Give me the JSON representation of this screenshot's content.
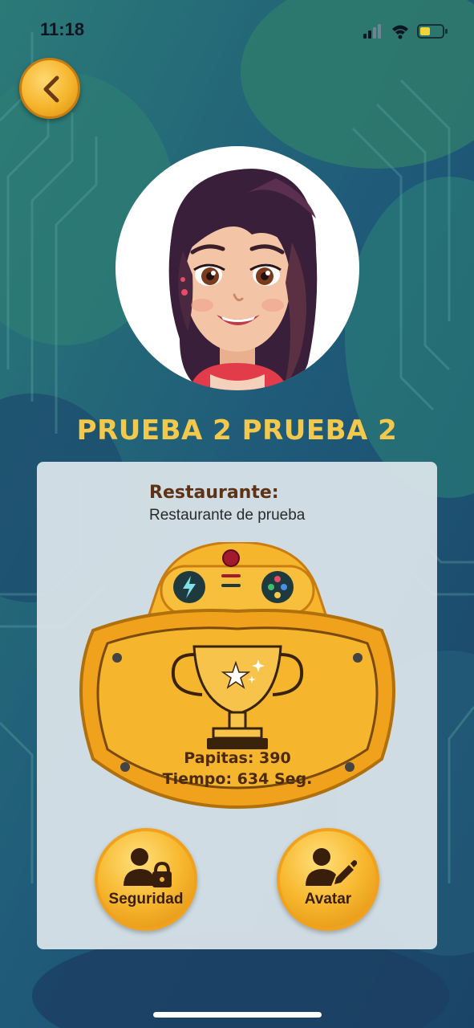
{
  "status_bar": {
    "time": "11:18"
  },
  "header": {
    "back_icon": "chevron-left-icon"
  },
  "profile": {
    "name": "PRUEBA 2 PRUEBA 2",
    "avatar": "girl-avatar-illustration"
  },
  "restaurant": {
    "label": "Restaurante:",
    "value": "Restaurante de prueba"
  },
  "stats": {
    "papitas": "Papitas: 390",
    "tiempo": "Tiempo: 634 Seg."
  },
  "actions": [
    {
      "label": "Seguridad",
      "icon": "user-lock-icon"
    },
    {
      "label": "Avatar",
      "icon": "user-edit-icon"
    }
  ],
  "colors": {
    "title": "#f2c94c",
    "gold": "#f5b52c",
    "brown_text": "#5e3216",
    "card_bg": "#dde6ec"
  }
}
